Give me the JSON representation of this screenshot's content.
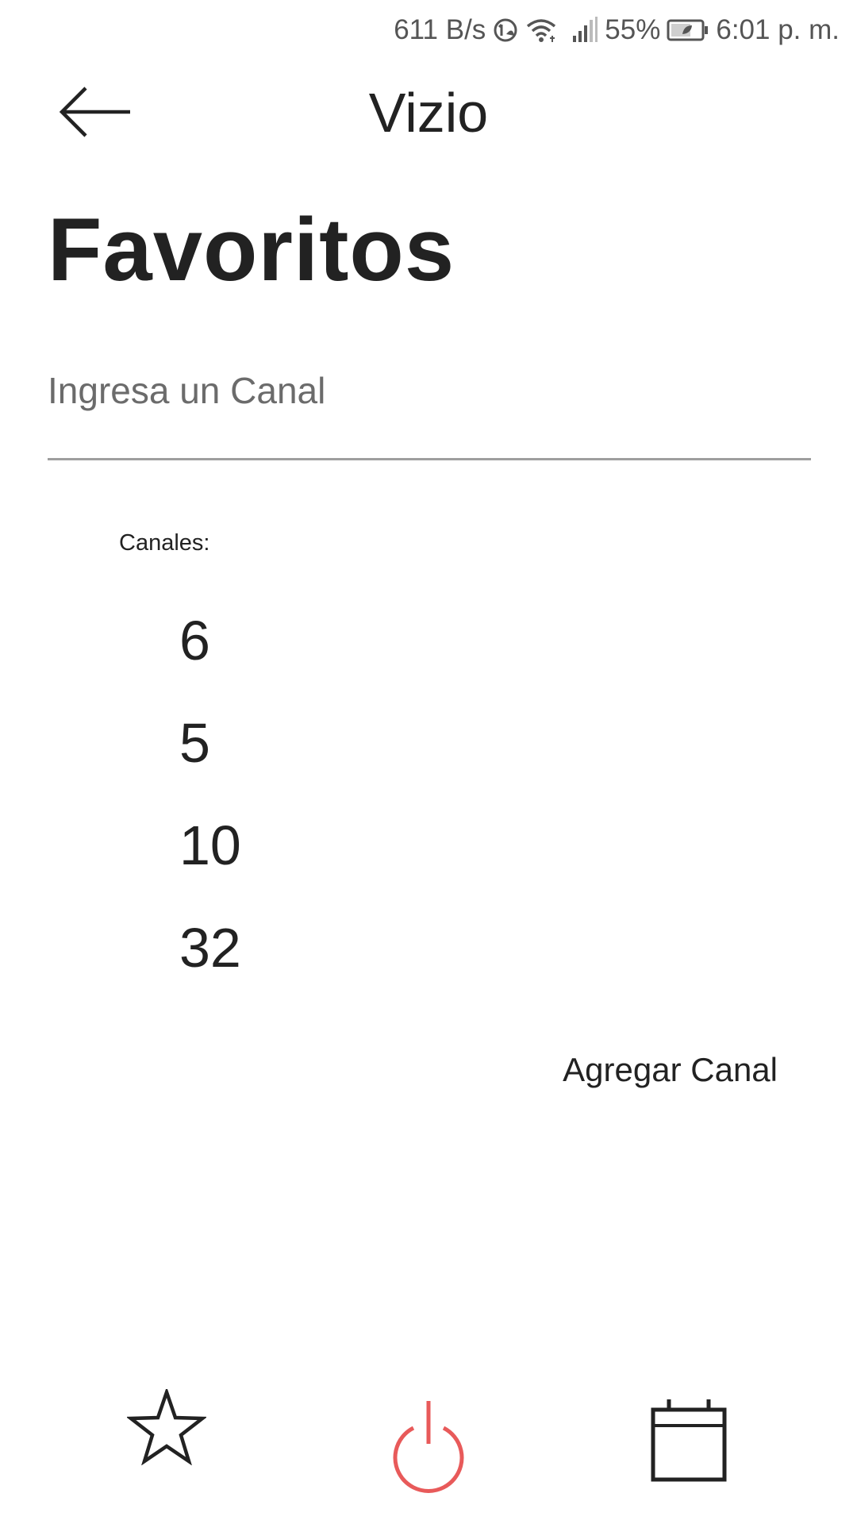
{
  "status_bar": {
    "network_speed": "611 B/s",
    "battery_percent": "55%",
    "time": "6:01 p. m.",
    "icons": [
      "data-saver-icon",
      "wifi-icon",
      "signal-icon",
      "battery-icon"
    ]
  },
  "app_bar": {
    "title": "Vizio",
    "back_icon": "arrow-left-icon"
  },
  "page": {
    "heading": "Favoritos"
  },
  "channel_input": {
    "value": "",
    "placeholder": "Ingresa un Canal"
  },
  "channels": {
    "label": "Canales:",
    "items": [
      "6",
      "5",
      "10",
      "32"
    ]
  },
  "actions": {
    "add_channel_label": "Agregar Canal"
  },
  "bottom_nav": {
    "items": [
      {
        "icon": "star-icon"
      },
      {
        "icon": "power-icon"
      },
      {
        "icon": "calendar-icon"
      }
    ]
  },
  "colors": {
    "text": "#222222",
    "status_text": "#555555",
    "placeholder": "#6b6b6b",
    "underline": "#9e9e9e",
    "power_accent": "#e85a5a"
  }
}
